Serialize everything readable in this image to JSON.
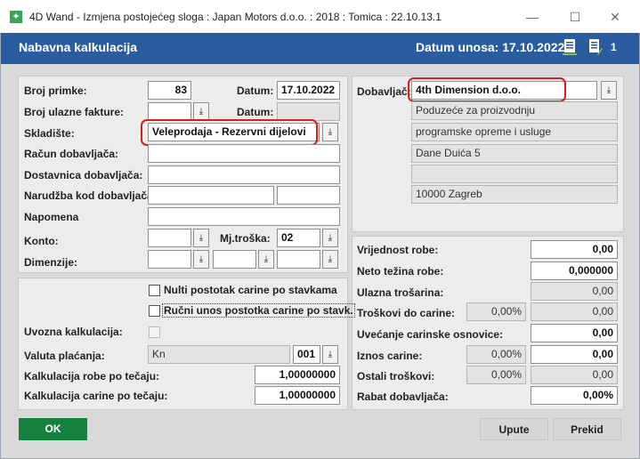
{
  "window": {
    "title": "4D Wand - Izmjena postojećeg sloga : Japan Motors d.o.o. : 2018 : Tomica : 22.10.13.1",
    "app_icon": "✦",
    "minimize": "—",
    "maximize": "☐",
    "close": "✕"
  },
  "header": {
    "title": "Nabavna kalkulacija",
    "date_text": "Datum unosa: 17.10.2022",
    "count": "1",
    "bg_color": "#2a5d9f"
  },
  "form": {
    "broj_primke_label": "Broj primke:",
    "broj_primke": "83",
    "datum_label": "Datum:",
    "datum": "17.10.2022",
    "broj_ulazne_label": "Broj ulazne fakture:",
    "broj_ulazne": "",
    "datum2_label": "Datum:",
    "datum2": "",
    "skladiste_label": "Skladište:",
    "skladiste": "Veleprodaja - Rezervni dijelovi",
    "racun_label": "Račun dobavljača:",
    "racun": "",
    "dostavnica_label": "Dostavnica dobavljača:",
    "dostavnica": "",
    "narudzba_label": "Narudžba kod dobavljača:",
    "narudzba": "",
    "narudzba2": "",
    "napomena_label": "Napomena",
    "napomena": "",
    "konto_label": "Konto:",
    "konto": "",
    "mjtroska_label": "Mj.troška:",
    "mjtroska": "02",
    "dimenzije_label": "Dimenzije:",
    "dim1": "",
    "dim2": "",
    "dim3": ""
  },
  "options": {
    "nulti_label": "Nulti postotak carine po stavkama",
    "rucni_label": "Ručni unos postotka carine po stavk.",
    "uvozna_label": "Uvozna kalkulacija:",
    "valuta_label": "Valuta plaćanja:",
    "valuta": "Kn",
    "valuta_code": "001",
    "kalk_robe_label": "Kalkulacija robe po tečaju:",
    "kalk_robe": "1,00000000",
    "kalk_carine_label": "Kalkulacija carine po tečaju:",
    "kalk_carine": "1,00000000"
  },
  "supplier": {
    "label": "Dobavljač:",
    "name": "4th Dimension d.o.o.",
    "line1": "Poduzeće za proizvodnju",
    "line2": "programske opreme i usluge",
    "line3": "Dane Duića 5",
    "line4": "",
    "line5": "10000 Zagreb"
  },
  "totals": {
    "vrijednost_label": "Vrijednost robe:",
    "vrijednost": "0,00",
    "neto_label": "Neto težina robe:",
    "neto": "0,000000",
    "ulazna_label": "Ulazna trošarina:",
    "ulazna": "0,00",
    "troskovi_label": "Troškovi do carine:",
    "troskovi_pct": "0,00%",
    "troskovi": "0,00",
    "uvecanje_label": "Uvećanje carinske osnovice:",
    "uvecanje": "0,00",
    "iznos_label": "Iznos carine:",
    "iznos_pct": "0,00%",
    "iznos": "0,00",
    "ostali_label": "Ostali troškovi:",
    "ostali_pct": "0,00%",
    "ostali": "0,00",
    "rabat_label": "Rabat dobavljača:",
    "rabat": "0,00%"
  },
  "buttons": {
    "ok": "OK",
    "upute": "Upute",
    "prekid": "Prekid"
  },
  "dropdown_glyph": "⤓"
}
